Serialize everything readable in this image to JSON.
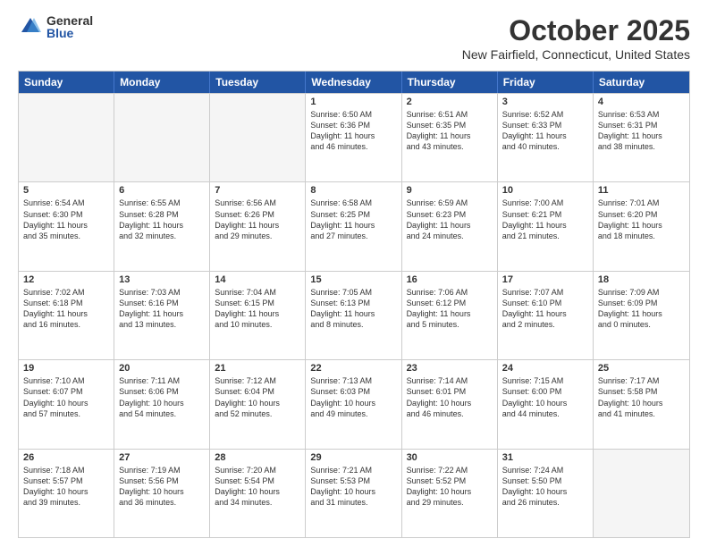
{
  "logo": {
    "general": "General",
    "blue": "Blue"
  },
  "header": {
    "month": "October 2025",
    "location": "New Fairfield, Connecticut, United States"
  },
  "days": [
    "Sunday",
    "Monday",
    "Tuesday",
    "Wednesday",
    "Thursday",
    "Friday",
    "Saturday"
  ],
  "weeks": [
    [
      {
        "day": "",
        "empty": true
      },
      {
        "day": "",
        "empty": true
      },
      {
        "day": "",
        "empty": true
      },
      {
        "day": "1",
        "lines": [
          "Sunrise: 6:50 AM",
          "Sunset: 6:36 PM",
          "Daylight: 11 hours",
          "and 46 minutes."
        ]
      },
      {
        "day": "2",
        "lines": [
          "Sunrise: 6:51 AM",
          "Sunset: 6:35 PM",
          "Daylight: 11 hours",
          "and 43 minutes."
        ]
      },
      {
        "day": "3",
        "lines": [
          "Sunrise: 6:52 AM",
          "Sunset: 6:33 PM",
          "Daylight: 11 hours",
          "and 40 minutes."
        ]
      },
      {
        "day": "4",
        "lines": [
          "Sunrise: 6:53 AM",
          "Sunset: 6:31 PM",
          "Daylight: 11 hours",
          "and 38 minutes."
        ]
      }
    ],
    [
      {
        "day": "5",
        "lines": [
          "Sunrise: 6:54 AM",
          "Sunset: 6:30 PM",
          "Daylight: 11 hours",
          "and 35 minutes."
        ]
      },
      {
        "day": "6",
        "lines": [
          "Sunrise: 6:55 AM",
          "Sunset: 6:28 PM",
          "Daylight: 11 hours",
          "and 32 minutes."
        ]
      },
      {
        "day": "7",
        "lines": [
          "Sunrise: 6:56 AM",
          "Sunset: 6:26 PM",
          "Daylight: 11 hours",
          "and 29 minutes."
        ]
      },
      {
        "day": "8",
        "lines": [
          "Sunrise: 6:58 AM",
          "Sunset: 6:25 PM",
          "Daylight: 11 hours",
          "and 27 minutes."
        ]
      },
      {
        "day": "9",
        "lines": [
          "Sunrise: 6:59 AM",
          "Sunset: 6:23 PM",
          "Daylight: 11 hours",
          "and 24 minutes."
        ]
      },
      {
        "day": "10",
        "lines": [
          "Sunrise: 7:00 AM",
          "Sunset: 6:21 PM",
          "Daylight: 11 hours",
          "and 21 minutes."
        ]
      },
      {
        "day": "11",
        "lines": [
          "Sunrise: 7:01 AM",
          "Sunset: 6:20 PM",
          "Daylight: 11 hours",
          "and 18 minutes."
        ]
      }
    ],
    [
      {
        "day": "12",
        "lines": [
          "Sunrise: 7:02 AM",
          "Sunset: 6:18 PM",
          "Daylight: 11 hours",
          "and 16 minutes."
        ]
      },
      {
        "day": "13",
        "lines": [
          "Sunrise: 7:03 AM",
          "Sunset: 6:16 PM",
          "Daylight: 11 hours",
          "and 13 minutes."
        ]
      },
      {
        "day": "14",
        "lines": [
          "Sunrise: 7:04 AM",
          "Sunset: 6:15 PM",
          "Daylight: 11 hours",
          "and 10 minutes."
        ]
      },
      {
        "day": "15",
        "lines": [
          "Sunrise: 7:05 AM",
          "Sunset: 6:13 PM",
          "Daylight: 11 hours",
          "and 8 minutes."
        ]
      },
      {
        "day": "16",
        "lines": [
          "Sunrise: 7:06 AM",
          "Sunset: 6:12 PM",
          "Daylight: 11 hours",
          "and 5 minutes."
        ]
      },
      {
        "day": "17",
        "lines": [
          "Sunrise: 7:07 AM",
          "Sunset: 6:10 PM",
          "Daylight: 11 hours",
          "and 2 minutes."
        ]
      },
      {
        "day": "18",
        "lines": [
          "Sunrise: 7:09 AM",
          "Sunset: 6:09 PM",
          "Daylight: 11 hours",
          "and 0 minutes."
        ]
      }
    ],
    [
      {
        "day": "19",
        "lines": [
          "Sunrise: 7:10 AM",
          "Sunset: 6:07 PM",
          "Daylight: 10 hours",
          "and 57 minutes."
        ]
      },
      {
        "day": "20",
        "lines": [
          "Sunrise: 7:11 AM",
          "Sunset: 6:06 PM",
          "Daylight: 10 hours",
          "and 54 minutes."
        ]
      },
      {
        "day": "21",
        "lines": [
          "Sunrise: 7:12 AM",
          "Sunset: 6:04 PM",
          "Daylight: 10 hours",
          "and 52 minutes."
        ]
      },
      {
        "day": "22",
        "lines": [
          "Sunrise: 7:13 AM",
          "Sunset: 6:03 PM",
          "Daylight: 10 hours",
          "and 49 minutes."
        ]
      },
      {
        "day": "23",
        "lines": [
          "Sunrise: 7:14 AM",
          "Sunset: 6:01 PM",
          "Daylight: 10 hours",
          "and 46 minutes."
        ]
      },
      {
        "day": "24",
        "lines": [
          "Sunrise: 7:15 AM",
          "Sunset: 6:00 PM",
          "Daylight: 10 hours",
          "and 44 minutes."
        ]
      },
      {
        "day": "25",
        "lines": [
          "Sunrise: 7:17 AM",
          "Sunset: 5:58 PM",
          "Daylight: 10 hours",
          "and 41 minutes."
        ]
      }
    ],
    [
      {
        "day": "26",
        "lines": [
          "Sunrise: 7:18 AM",
          "Sunset: 5:57 PM",
          "Daylight: 10 hours",
          "and 39 minutes."
        ]
      },
      {
        "day": "27",
        "lines": [
          "Sunrise: 7:19 AM",
          "Sunset: 5:56 PM",
          "Daylight: 10 hours",
          "and 36 minutes."
        ]
      },
      {
        "day": "28",
        "lines": [
          "Sunrise: 7:20 AM",
          "Sunset: 5:54 PM",
          "Daylight: 10 hours",
          "and 34 minutes."
        ]
      },
      {
        "day": "29",
        "lines": [
          "Sunrise: 7:21 AM",
          "Sunset: 5:53 PM",
          "Daylight: 10 hours",
          "and 31 minutes."
        ]
      },
      {
        "day": "30",
        "lines": [
          "Sunrise: 7:22 AM",
          "Sunset: 5:52 PM",
          "Daylight: 10 hours",
          "and 29 minutes."
        ]
      },
      {
        "day": "31",
        "lines": [
          "Sunrise: 7:24 AM",
          "Sunset: 5:50 PM",
          "Daylight: 10 hours",
          "and 26 minutes."
        ]
      },
      {
        "day": "",
        "empty": true
      }
    ]
  ]
}
